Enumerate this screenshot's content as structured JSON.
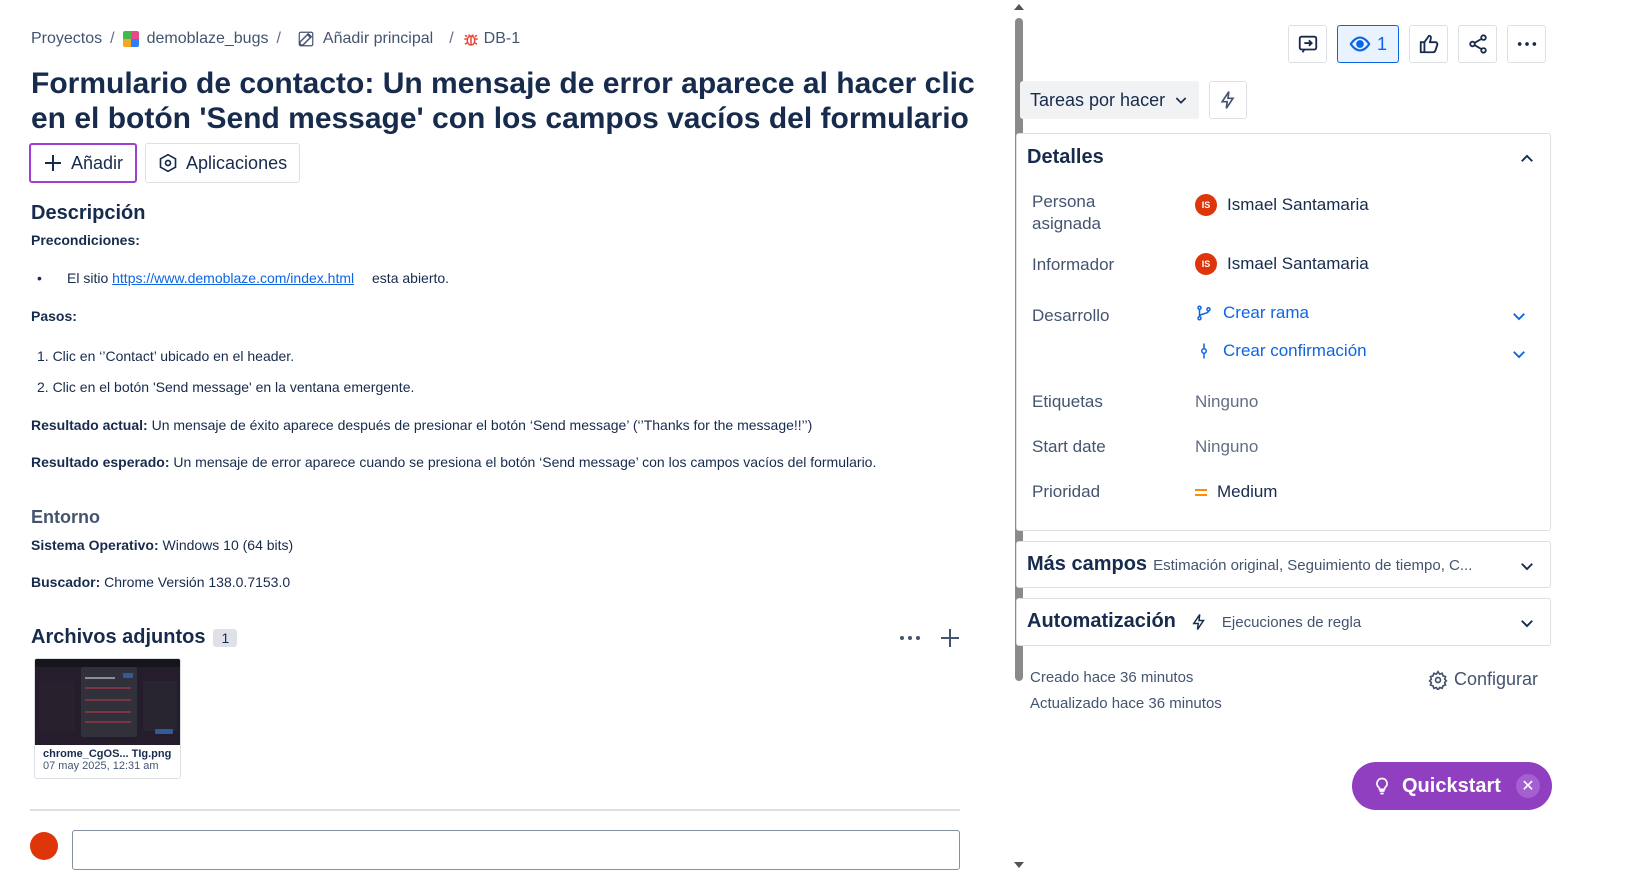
{
  "breadcrumb": {
    "projects": "Proyectos",
    "project": "demoblaze_bugs",
    "add_parent": "Añadir principal",
    "issue_key": "DB-1"
  },
  "issue": {
    "title": "Formulario de contacto: Un mensaje de error aparece al hacer clic en el botón 'Send message' con los campos vacíos del formulario"
  },
  "actions": {
    "add_label": "Añadir",
    "apps_label": "Aplicaciones"
  },
  "description": {
    "heading": "Descripción",
    "preconditions_label": "Precondiciones:",
    "bullet_prefix": "El sitio ",
    "bullet_link": "https://www.demoblaze.com/index.html",
    "bullet_suffix": " esta abierto.",
    "steps_label": "Pasos:",
    "step1": "1. Clic en ‘’Contact’ ubicado en el header.",
    "step2": "2. Clic en el botón 'Send message' en la ventana emergente.",
    "actual_label": "Resultado actual:",
    "actual_text": " Un mensaje de éxito aparece después de presionar el botón ‘Send message’ (‘’Thanks for the message!!’’)",
    "expected_label": "Resultado esperado:",
    "expected_text": " Un mensaje de error aparece cuando se presiona el botón ‘Send message’ con los campos vacíos del formulario."
  },
  "environment": {
    "heading": "Entorno",
    "os_label": "Sistema Operativo:",
    "os_value": " Windows 10 (64 bits)",
    "browser_label": "Buscador:",
    "browser_value": " Chrome Versión 138.0.7153.0"
  },
  "attachments": {
    "heading": "Archivos adjuntos",
    "count": "1",
    "items": [
      {
        "name": "chrome_CgOS... TIg.png",
        "date": "07 may 2025, 12:31 am"
      }
    ]
  },
  "topbar": {
    "watch_count": "1"
  },
  "status": {
    "label": "Tareas por hacer"
  },
  "details": {
    "heading": "Detalles",
    "assignee_label": "Persona asignada",
    "assignee_name": "Ismael Santamaria",
    "assignee_initials": "IS",
    "reporter_label": "Informador",
    "reporter_name": "Ismael Santamaria",
    "reporter_initials": "IS",
    "development_label": "Desarrollo",
    "create_branch": "Crear rama",
    "create_commit": "Crear confirmación",
    "labels_label": "Etiquetas",
    "labels_value": "Ninguno",
    "start_date_label": "Start date",
    "start_date_value": "Ninguno",
    "priority_label": "Prioridad",
    "priority_value": "Medium"
  },
  "more_fields": {
    "title": "Más campos",
    "subtitle": "Estimación original, Seguimiento de tiempo, C..."
  },
  "automation": {
    "title": "Automatización",
    "subtitle": "Ejecuciones de regla"
  },
  "meta": {
    "created": "Creado hace 36 minutos",
    "updated": "Actualizado hace 36 minutos",
    "configure": "Configurar"
  },
  "quickstart": {
    "label": "Quickstart"
  },
  "colors": {
    "accent_purple": "#8f3fbf",
    "link_blue": "#0c66e4",
    "avatar_red": "#de350b",
    "priority_orange": "#ff8b00"
  }
}
